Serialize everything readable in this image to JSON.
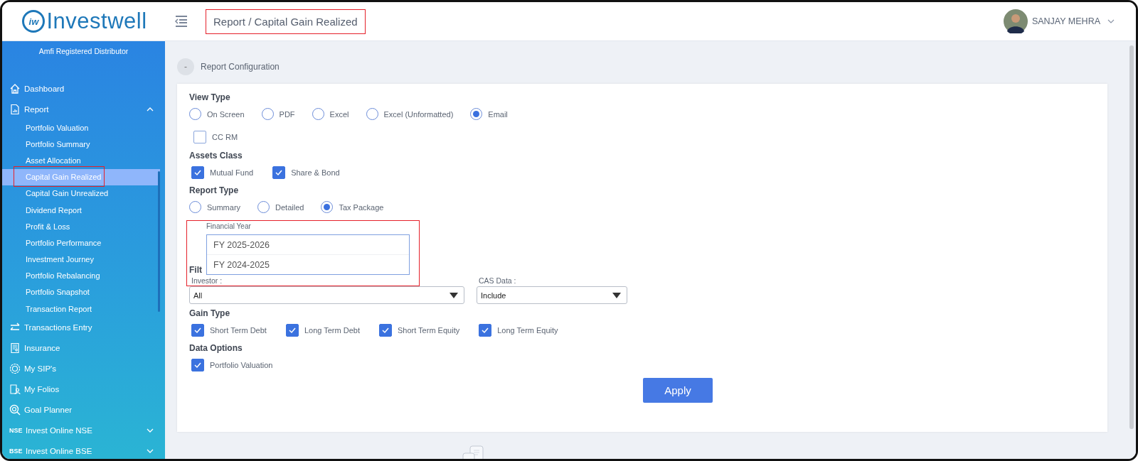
{
  "header": {
    "logo_mark": "iw",
    "logo": "Investwell",
    "breadcrumb": "Report / Capital Gain Realized",
    "breadcrumb_highlighted": true,
    "user_name": "SANJAY MEHRA"
  },
  "sidebar": {
    "subtitle": "Amfi Registered Distributor",
    "items": [
      {
        "label": "Dashboard"
      },
      {
        "label": "Report",
        "expanded": true,
        "children": [
          {
            "label": "Portfolio Valuation",
            "selected": false,
            "highlighted": false
          },
          {
            "label": "Portfolio Summary",
            "selected": false,
            "highlighted": false
          },
          {
            "label": "Asset Allocation",
            "selected": false,
            "highlighted": false
          },
          {
            "label": "Capital Gain Realized",
            "selected": true,
            "highlighted": true
          },
          {
            "label": "Capital Gain Unrealized",
            "selected": false,
            "highlighted": false
          },
          {
            "label": "Dividend Report",
            "selected": false,
            "highlighted": false
          },
          {
            "label": "Profit & Loss",
            "selected": false,
            "highlighted": false
          },
          {
            "label": "Portfolio Performance",
            "selected": false,
            "highlighted": false
          },
          {
            "label": "Investment Journey",
            "selected": false,
            "highlighted": false
          },
          {
            "label": "Portfolio Rebalancing",
            "selected": false,
            "highlighted": false
          },
          {
            "label": "Portfolio Snapshot",
            "selected": false,
            "highlighted": false
          },
          {
            "label": "Transaction Report",
            "selected": false,
            "highlighted": false
          }
        ]
      },
      {
        "label": "Transactions Entry"
      },
      {
        "label": "Insurance"
      },
      {
        "label": "My SIP's"
      },
      {
        "label": "My Folios"
      },
      {
        "label": "Goal Planner"
      },
      {
        "badge": "NSE",
        "label": "Invest Online NSE",
        "expanded": false
      },
      {
        "badge": "BSE",
        "label": "Invest Online BSE",
        "expanded": false
      }
    ]
  },
  "section": {
    "toggle": "-",
    "title": "Report Configuration"
  },
  "form": {
    "view_type": {
      "label": "View Type",
      "options": [
        {
          "label": "On Screen",
          "selected": false
        },
        {
          "label": "PDF",
          "selected": false
        },
        {
          "label": "Excel",
          "selected": false
        },
        {
          "label": "Excel (Unformatted)",
          "selected": false
        },
        {
          "label": "Email",
          "selected": true
        }
      ]
    },
    "cc_rm": {
      "label": "CC RM",
      "checked": false
    },
    "assets_class": {
      "label": "Assets Class",
      "options": [
        {
          "label": "Mutual Fund",
          "checked": true
        },
        {
          "label": "Share & Bond",
          "checked": true
        }
      ]
    },
    "report_type": {
      "label": "Report Type",
      "options": [
        {
          "label": "Summary",
          "selected": false
        },
        {
          "label": "Detailed",
          "selected": false
        },
        {
          "label": "Tax Package",
          "selected": true
        }
      ]
    },
    "financial_year": {
      "label": "Financial Year",
      "highlighted": true,
      "options": [
        "FY 2025-2026",
        "FY 2024-2025"
      ]
    },
    "filters": {
      "label": "Filt",
      "investor": {
        "label": "Investor :",
        "value": "All"
      },
      "cas_data": {
        "label": "CAS Data :",
        "value": "Include"
      }
    },
    "gain_type": {
      "label": "Gain Type",
      "options": [
        {
          "label": "Short Term Debt",
          "checked": true
        },
        {
          "label": "Long Term Debt",
          "checked": true
        },
        {
          "label": "Short Term Equity",
          "checked": true
        },
        {
          "label": "Long Term Equity",
          "checked": true
        }
      ]
    },
    "data_options": {
      "label": "Data Options",
      "options": [
        {
          "label": "Portfolio Valuation",
          "checked": true
        }
      ]
    },
    "apply": "Apply"
  }
}
